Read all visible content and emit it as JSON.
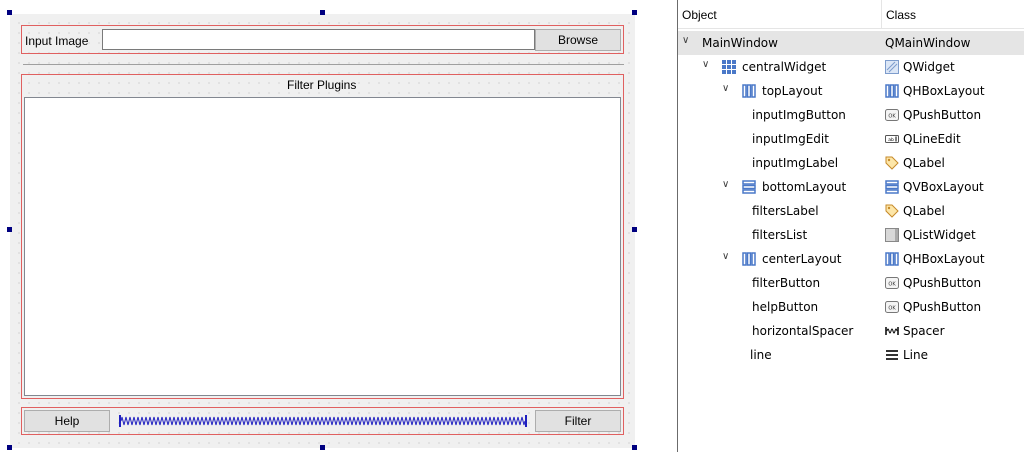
{
  "designer": {
    "input_label": "Input Image",
    "input_value": "",
    "browse_label": "Browse",
    "filters_label": "Filter Plugins",
    "help_label": "Help",
    "filter_label": "Filter"
  },
  "inspector": {
    "col_object": "Object",
    "col_class": "Class",
    "rows": [
      {
        "name": "MainWindow",
        "cls": "QMainWindow",
        "icon": "none",
        "cls_icon": "none"
      },
      {
        "name": "centralWidget",
        "cls": "QWidget",
        "icon": "grid-layout-icon",
        "cls_icon": "widget-icon"
      },
      {
        "name": "topLayout",
        "cls": "QHBoxLayout",
        "icon": "hbox-layout-icon",
        "cls_icon": "hbox-layout-icon"
      },
      {
        "name": "inputImgButton",
        "cls": "QPushButton",
        "icon": "none",
        "cls_icon": "push-button-icon"
      },
      {
        "name": "inputImgEdit",
        "cls": "QLineEdit",
        "icon": "none",
        "cls_icon": "line-edit-icon"
      },
      {
        "name": "inputImgLabel",
        "cls": "QLabel",
        "icon": "none",
        "cls_icon": "label-tag-icon"
      },
      {
        "name": "bottomLayout",
        "cls": "QVBoxLayout",
        "icon": "vbox-layout-icon",
        "cls_icon": "vbox-layout-icon"
      },
      {
        "name": "filtersLabel",
        "cls": "QLabel",
        "icon": "none",
        "cls_icon": "label-tag-icon"
      },
      {
        "name": "filtersList",
        "cls": "QListWidget",
        "icon": "none",
        "cls_icon": "list-widget-icon"
      },
      {
        "name": "centerLayout",
        "cls": "QHBoxLayout",
        "icon": "hbox-layout-icon",
        "cls_icon": "hbox-layout-icon"
      },
      {
        "name": "filterButton",
        "cls": "QPushButton",
        "icon": "none",
        "cls_icon": "push-button-icon"
      },
      {
        "name": "helpButton",
        "cls": "QPushButton",
        "icon": "none",
        "cls_icon": "push-button-icon"
      },
      {
        "name": "horizontalSpacer",
        "cls": "Spacer",
        "icon": "none",
        "cls_icon": "spacer-icon"
      },
      {
        "name": "line",
        "cls": "Line",
        "icon": "none",
        "cls_icon": "line-icon"
      }
    ]
  },
  "colors": {
    "selection": "#e5e5e5",
    "layout_border": "#e06060",
    "handle": "#000080",
    "spacer": "#2020c0"
  }
}
